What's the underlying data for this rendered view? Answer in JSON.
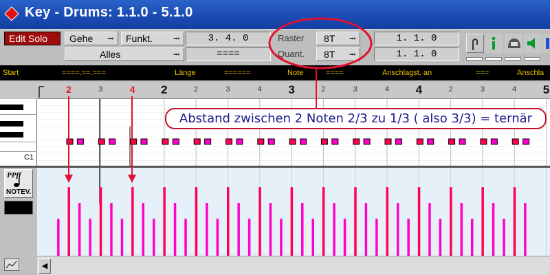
{
  "window": {
    "title": "Key - Drums:  1.1.0 - 5.1.0"
  },
  "toolbar": {
    "edit_solo_label": "Edit Solo",
    "goto_label": "Gehe",
    "function_label": "Funkt.",
    "show_label": "Alles",
    "position_value": "3.  4.    0",
    "length_value": "====",
    "raster_label": "Raster",
    "raster_value": "8T",
    "quant_label": "Quant.",
    "quant_value": "8T",
    "left_locator": "1.   1.    0",
    "right_locator": "1.   1.    0"
  },
  "infobar": {
    "start_label": "Start",
    "start_value": "====.==.===",
    "length_label": "Länge",
    "length_value": "======",
    "note_label": "Note",
    "note_value": "====",
    "velocity_on_label": "Anschlagst. an",
    "velocity_on_value": "===",
    "velocity_off_label": "Anschla"
  },
  "ruler": {
    "ticks": [
      {
        "label": "2",
        "type": "red"
      },
      {
        "label": "3",
        "type": "minor"
      },
      {
        "label": "4",
        "type": "red"
      },
      {
        "label": "2",
        "type": "major"
      },
      {
        "label": "2",
        "type": "minor"
      },
      {
        "label": "3",
        "type": "minor"
      },
      {
        "label": "4",
        "type": "minor"
      },
      {
        "label": "3",
        "type": "major"
      },
      {
        "label": "2",
        "type": "minor"
      },
      {
        "label": "3",
        "type": "minor"
      },
      {
        "label": "4",
        "type": "minor"
      },
      {
        "label": "4",
        "type": "major"
      },
      {
        "label": "2",
        "type": "minor"
      },
      {
        "label": "3",
        "type": "minor"
      },
      {
        "label": "4",
        "type": "minor"
      },
      {
        "label": "5",
        "type": "major"
      }
    ]
  },
  "piano": {
    "c1_label": "C1"
  },
  "notev": {
    "dynamics": "PPff",
    "label": "NOTEV."
  },
  "callout": {
    "text": "Abstand zwischen 2 Noten 2/3 zu 1/3 ( also 3/3) = ternär"
  },
  "notes": {
    "beat_count": 16,
    "pattern": [
      {
        "offset": 0.0,
        "velocity": 0.78,
        "color": "#ff0055"
      },
      {
        "offset": 0.333,
        "velocity": 0.6,
        "color": "#ff00cc"
      }
    ],
    "first_offset": 0.0,
    "extra_low": 0.42,
    "accent_color": "#ff0055",
    "ghost_color": "#ff00cc"
  },
  "colors": {
    "title_bar": "#1d4fb7",
    "edit_solo": "#9e0b0b",
    "info_text": "#f0c000",
    "annotation": "#e01030",
    "callout_text": "#1a1a8c"
  }
}
